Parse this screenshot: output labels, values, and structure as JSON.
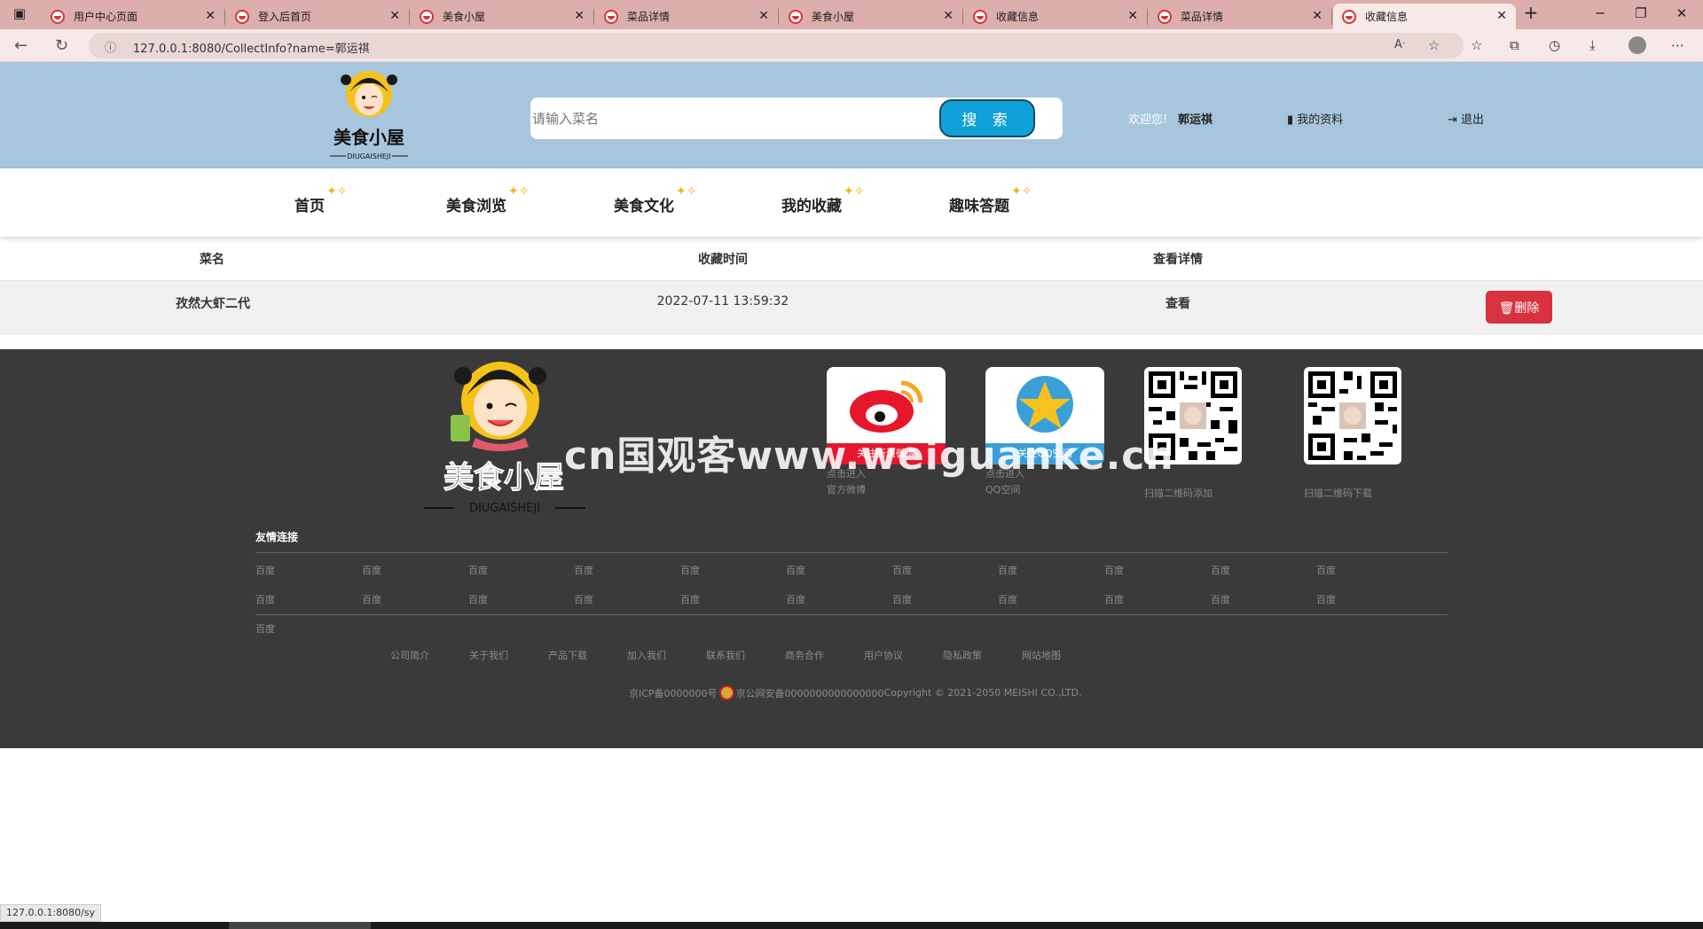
{
  "browser": {
    "tabs": [
      {
        "title": "用户中心页面"
      },
      {
        "title": "登入后首页"
      },
      {
        "title": "美食小屋"
      },
      {
        "title": "菜品详情"
      },
      {
        "title": "美食小屋"
      },
      {
        "title": "收藏信息"
      },
      {
        "title": "菜品详情"
      },
      {
        "title": "收藏信息",
        "active": true
      }
    ],
    "url": "127.0.0.1:8080/CollectInfo?name=郭运祺",
    "status_url": "127.0.0.1:8080/sy",
    "icons": [
      "sidebar-icon",
      "back-icon",
      "refresh-icon",
      "info-icon",
      "read-aloud-icon",
      "add-favorite-icon",
      "favorites-icon",
      "collections-icon",
      "history-icon",
      "download-icon",
      "profile-icon",
      "more-icon",
      "new-tab-icon",
      "minimize-icon",
      "restore-icon",
      "close-icon"
    ]
  },
  "header": {
    "logo_text": "美食小屋",
    "logo_sub": "DIUGAISHEJI",
    "search_placeholder": "请输入菜名",
    "search_button": "搜 索",
    "welcome": "欢迎您!",
    "username": "郭运祺",
    "profile_link": "我的资料",
    "logout_link": "退出"
  },
  "nav": {
    "items": [
      "首页",
      "美食浏览",
      "美食文化",
      "我的收藏",
      "趣味答题"
    ]
  },
  "table": {
    "headers": [
      "菜名",
      "收藏时间",
      "查看详情"
    ],
    "rows": [
      {
        "name": "孜然大虾二代",
        "time": "2022-07-11 13:59:32",
        "view": "查看",
        "delete": "删除"
      }
    ]
  },
  "footer": {
    "logo_text": "美食小屋",
    "logo_sub": "DIUGAISHEJI",
    "weibo": {
      "caption": "关注新浪微博",
      "line1": "点击进入",
      "line2": "官方微博"
    },
    "qq": {
      "caption": "关注QQ空间",
      "line1": "点击进入",
      "line2": "QQ空间"
    },
    "qr1_caption": "扫描二维码添加",
    "qr2_caption": "扫描二维码下载",
    "watermark": "cn国观客www.weiguanke.cn",
    "friend_links_title": "友情连接",
    "friend_links": [
      "百度",
      "百度",
      "百度",
      "百度",
      "百度",
      "百度",
      "百度",
      "百度",
      "百度",
      "百度",
      "百度",
      "百度",
      "百度",
      "百度",
      "百度",
      "百度",
      "百度",
      "百度",
      "百度",
      "百度",
      "百度",
      "百度",
      "百度"
    ],
    "bottom_links": [
      "公司简介",
      "关于我们",
      "产品下载",
      "加入我们",
      "联系我们",
      "商务合作",
      "用户协议",
      "隐私政策",
      "网站地图"
    ],
    "icp": "京ICP备0000000号",
    "police": "京公网安备0000000000000000",
    "copyright": "Copyright © 2021-2050 MEISHI CO.,LTD."
  },
  "colors": {
    "header_bg": "#a7c6dd",
    "search_button": "#0fa1d8",
    "delete_button": "#d9323f",
    "footer_bg": "#3a3a3a",
    "tabbar_bg": "#dcaeac"
  }
}
